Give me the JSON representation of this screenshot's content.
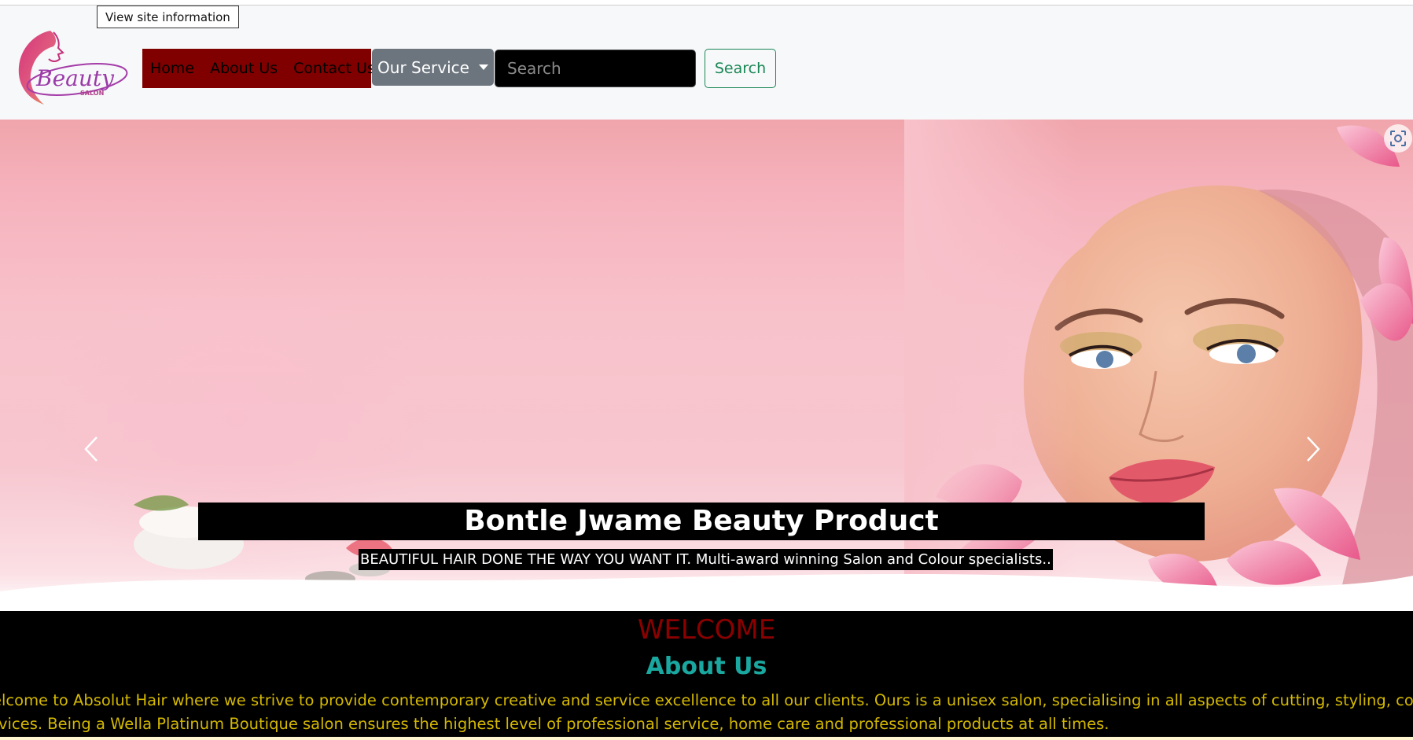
{
  "browser": {
    "tooltip": "View site information"
  },
  "header": {
    "logo": {
      "text": "Beauty",
      "subtext": "SALON"
    },
    "nav": {
      "home": "Home",
      "about": "About Us",
      "contact": "Contact Us"
    },
    "service_dropdown": "Our Service",
    "search_placeholder": "Search",
    "search_button": "Search"
  },
  "hero": {
    "title": "Bontle Jwame Beauty Product",
    "subtitle": "BEAUTIFUL HAIR DONE THE WAY YOU WANT IT. Multi-award winning Salon and Colour specialists.."
  },
  "welcome": {
    "title": "WELCOME",
    "heading": "About Us",
    "line1": "elcome to Absolut Hair where we strive to provide contemporary creative and service excellence to all our clients. Ours is a unisex salon, specialising in all aspects of cutting, styling, colour and chemical",
    "line2": "rvices. Being a Wella Platinum Boutique salon ensures the highest level of professional service, home care and professional products at all times."
  },
  "colors": {
    "nav_bg": "#800000",
    "dropdown_bg": "#6c757d",
    "search_btn": "#198754",
    "welcome_title": "#8b0000",
    "about_heading": "#1aa7a0",
    "about_text": "#d4b800"
  }
}
